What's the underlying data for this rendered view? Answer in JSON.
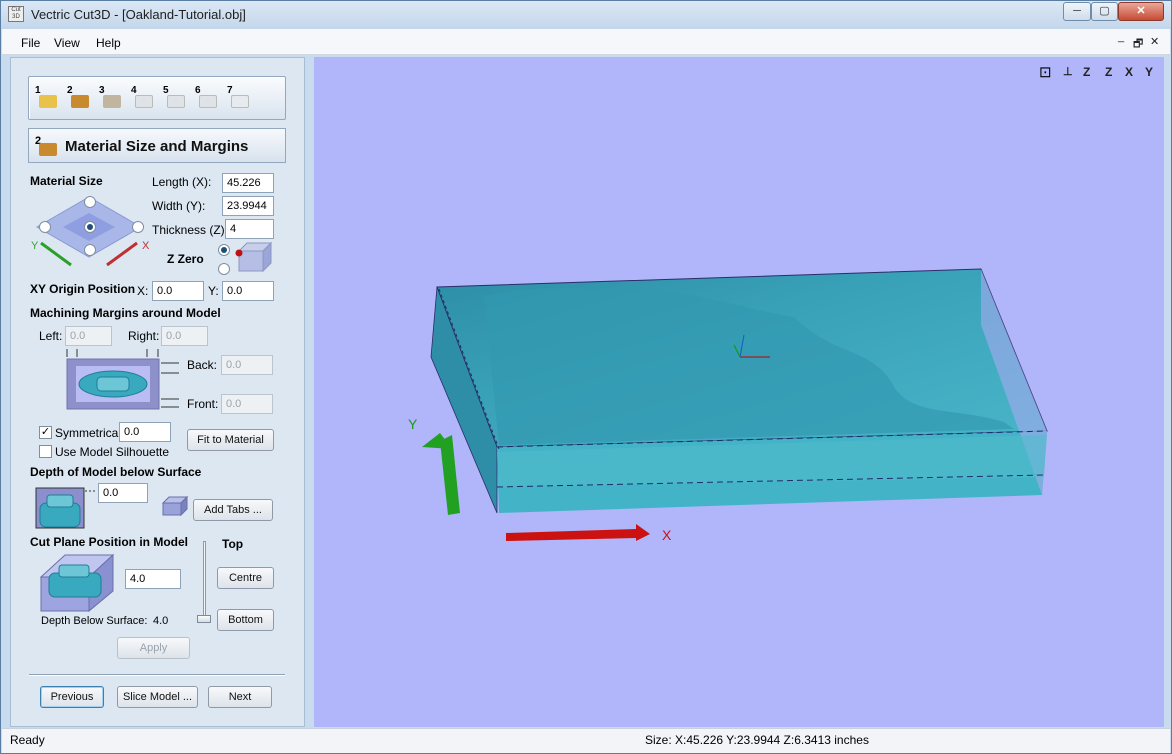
{
  "window": {
    "app_icon_text": "Cut 3D",
    "title": "Vectric Cut3D - [Oakland-Tutorial.obj]",
    "min": "─",
    "max": "▢",
    "close": "✕"
  },
  "menu": {
    "file": "File",
    "view": "View",
    "help": "Help",
    "mdi_min": "_",
    "mdi_restore": "🗗",
    "mdi_close": "✕"
  },
  "toolbar": {
    "steps": [
      "1",
      "2",
      "3",
      "4",
      "5",
      "6",
      "7"
    ]
  },
  "section": {
    "number": "2",
    "title": "Material Size and Margins"
  },
  "material": {
    "label": "Material Size",
    "length_label": "Length (X):",
    "length": "45.226",
    "width_label": "Width (Y):",
    "width": "23.9944",
    "thickness_label": "Thickness (Z):",
    "thickness": "4",
    "zzero_label": "Z Zero",
    "y_axis": "Y",
    "x_axis": "X"
  },
  "origin": {
    "label": "XY Origin Position",
    "x_label": "X:",
    "x": "0.0",
    "y_label": "Y:",
    "y": "0.0"
  },
  "margins": {
    "label": "Machining Margins around Model",
    "left_label": "Left:",
    "left": "0.0",
    "right_label": "Right:",
    "right": "0.0",
    "back_label": "Back:",
    "back": "0.0",
    "front_label": "Front:",
    "front": "0.0",
    "symmetrical_label": "Symmetrical",
    "symmetrical_checked": "✓",
    "symmetrical": "0.0",
    "silhouette_label": "Use Model Silhouette",
    "fit_button": "Fit to Material"
  },
  "depth": {
    "label": "Depth of Model below Surface",
    "value": "0.0",
    "tabs_button": "Add Tabs ..."
  },
  "cutplane": {
    "label": "Cut Plane Position in Model",
    "value": "4.0",
    "top_label": "Top",
    "centre_button": "Centre",
    "bottom_button": "Bottom",
    "depth_label": "Depth Below Surface:",
    "depth_value": "4.0",
    "apply_button": "Apply"
  },
  "nav": {
    "previous": "Previous",
    "slice": "Slice Model ...",
    "next": "Next"
  },
  "viewport": {
    "axis_x": "X",
    "axis_y": "Y",
    "view_icons": [
      "⊡",
      "Z",
      "Z",
      "X",
      "Y"
    ]
  },
  "status": {
    "left": "Ready",
    "right": "Size: X:45.226 Y:23.9944 Z:6.3413 inches"
  },
  "colors": {
    "viewport_bg": "#b1b5fa",
    "model": "#3aa8bf",
    "axis_x": "#d01212",
    "axis_y": "#1e9a1e"
  }
}
